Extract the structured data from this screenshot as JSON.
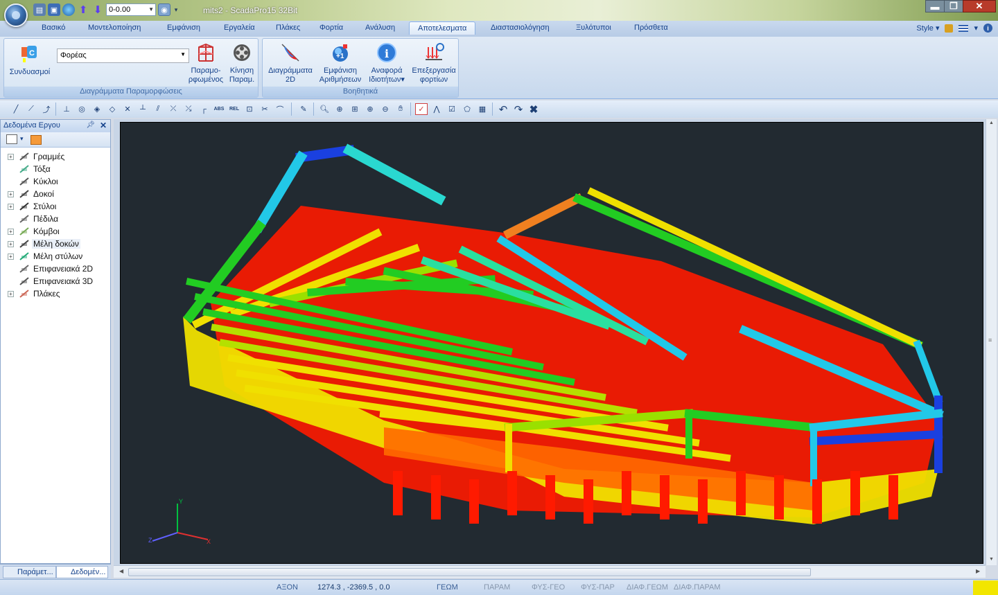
{
  "window": {
    "title": "mits2 - ScadaPro15 32Bit",
    "level_value": "0-0.00"
  },
  "tabs": [
    "Βασικό",
    "Μοντελοποίηση",
    "Εμφάνιση",
    "Εργαλεία",
    "Πλάκες",
    "Φορτία",
    "Ανάλυση",
    "Αποτελεσματα",
    "Διαστασιολόγηση",
    "Ξυλότυποι",
    "Πρόσθετα"
  ],
  "active_tab": "Αποτελεσματα",
  "style_label": "Style",
  "ribbon": {
    "group1": {
      "combinations_label": "Συνδυασμοί",
      "carrier_value": "Φορέας",
      "deformed_label_1": "Παραμο-",
      "deformed_label_2": "ρφωμένος",
      "motion_label_1": "Κίνηση",
      "motion_label_2": "Παραμ.",
      "group_label": "Διαγράμματα Παραμορφώσεις"
    },
    "group2": {
      "diagrams_label_1": "Διαγράμματα",
      "diagrams_label_2": "2D",
      "numbers_label_1": "Εμφάνιση",
      "numbers_label_2": "Αριθμήσεων",
      "report_label_1": "Αναφορά",
      "report_label_2": "Ιδιοτήτων",
      "loads_label_1": "Επεξεργασία",
      "loads_label_2": "φορτίων",
      "group_label": "Βοηθητικά"
    }
  },
  "panel": {
    "title": "Δεδομένα Εργου",
    "tree": [
      {
        "label": "Γραμμές",
        "expandable": true,
        "icon": "line-icon"
      },
      {
        "label": "Τόξα",
        "expandable": false,
        "icon": "arc-icon"
      },
      {
        "label": "Κύκλοι",
        "expandable": false,
        "icon": "circle-icon"
      },
      {
        "label": "Δοκοί",
        "expandable": true,
        "icon": "beam-icon"
      },
      {
        "label": "Στύλοι",
        "expandable": true,
        "icon": "column-icon"
      },
      {
        "label": "Πέδιλα",
        "expandable": false,
        "icon": "footing-icon"
      },
      {
        "label": "Κόμβοι",
        "expandable": true,
        "icon": "node-icon"
      },
      {
        "label": "Μέλη δοκών",
        "expandable": true,
        "icon": "beam-member-icon"
      },
      {
        "label": "Μέλη στύλων",
        "expandable": true,
        "icon": "column-member-icon"
      },
      {
        "label": "Επιφανειακά 2D",
        "expandable": false,
        "icon": "surface-2d-icon"
      },
      {
        "label": "Επιφανειακά 3D",
        "expandable": false,
        "icon": "surface-3d-icon"
      },
      {
        "label": "Πλάκες",
        "expandable": true,
        "icon": "slab-icon"
      }
    ],
    "selected_item": "Μέλη δοκών",
    "bottom_tabs": [
      "Παράμετ...",
      "Δεδομέν..."
    ]
  },
  "axis_labels": {
    "x": "X",
    "y": "Y",
    "z": "Z"
  },
  "status": {
    "axon": "ΑΞΟΝ",
    "coords": "1274.3 , -2369.5 , 0.0",
    "geom": "ΓΕΩΜ",
    "param": "ΠΑΡΑΜ",
    "fys_geo": "ΦΥΣ-ΓΕΟ",
    "fys_par": "ΦΥΣ-ΠΑΡ",
    "diaf_geom": "ΔΙΑΦ.ΓΕΩΜ",
    "diaf_param": "ΔΙΑΦ.ΠΑΡΑΜ"
  },
  "colors": {
    "viewport_bg": "#222a31",
    "accent": "#15428b",
    "contour_red": "#ff1a00",
    "contour_yellow": "#f0e000",
    "contour_green": "#22cc22",
    "contour_cyan": "#22c8e8",
    "contour_blue": "#1a40e0"
  }
}
